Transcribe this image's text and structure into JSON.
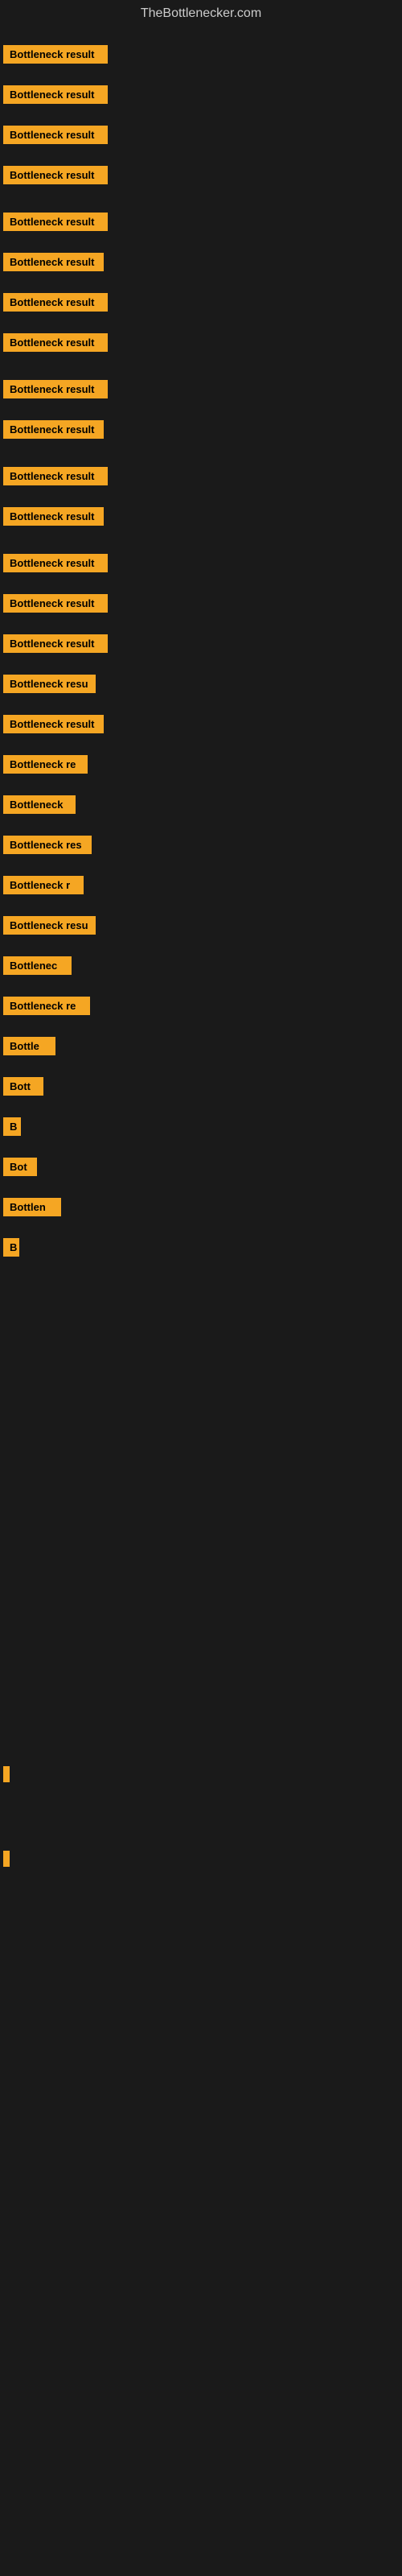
{
  "site": {
    "title": "TheBottlenecker.com"
  },
  "bars": [
    {
      "id": 1,
      "label": "Bottleneck result",
      "width": 130
    },
    {
      "id": 2,
      "label": "Bottleneck result",
      "width": 130
    },
    {
      "id": 3,
      "label": "Bottleneck result",
      "width": 130
    },
    {
      "id": 4,
      "label": "Bottleneck result",
      "width": 130
    },
    {
      "id": 5,
      "label": "Bottleneck result",
      "width": 130
    },
    {
      "id": 6,
      "label": "Bottleneck result",
      "width": 125
    },
    {
      "id": 7,
      "label": "Bottleneck result",
      "width": 130
    },
    {
      "id": 8,
      "label": "Bottleneck result",
      "width": 130
    },
    {
      "id": 9,
      "label": "Bottleneck result",
      "width": 130
    },
    {
      "id": 10,
      "label": "Bottleneck result",
      "width": 125
    },
    {
      "id": 11,
      "label": "Bottleneck result",
      "width": 130
    },
    {
      "id": 12,
      "label": "Bottleneck result",
      "width": 125
    },
    {
      "id": 13,
      "label": "Bottleneck result",
      "width": 130
    },
    {
      "id": 14,
      "label": "Bottleneck result",
      "width": 130
    },
    {
      "id": 15,
      "label": "Bottleneck result",
      "width": 130
    },
    {
      "id": 16,
      "label": "Bottleneck resu",
      "width": 115
    },
    {
      "id": 17,
      "label": "Bottleneck result",
      "width": 125
    },
    {
      "id": 18,
      "label": "Bottleneck re",
      "width": 105
    },
    {
      "id": 19,
      "label": "Bottleneck",
      "width": 90
    },
    {
      "id": 20,
      "label": "Bottleneck res",
      "width": 110
    },
    {
      "id": 21,
      "label": "Bottleneck r",
      "width": 100
    },
    {
      "id": 22,
      "label": "Bottleneck resu",
      "width": 115
    },
    {
      "id": 23,
      "label": "Bottlenec",
      "width": 85
    },
    {
      "id": 24,
      "label": "Bottleneck re",
      "width": 108
    },
    {
      "id": 25,
      "label": "Bottle",
      "width": 65
    },
    {
      "id": 26,
      "label": "Bott",
      "width": 50
    },
    {
      "id": 27,
      "label": "B",
      "width": 22
    },
    {
      "id": 28,
      "label": "Bot",
      "width": 42
    },
    {
      "id": 29,
      "label": "Bottlen",
      "width": 72
    },
    {
      "id": 30,
      "label": "B",
      "width": 20
    }
  ],
  "bottom_bars": [
    {
      "id": 31,
      "width": 8
    },
    {
      "id": 32,
      "width": 8
    }
  ],
  "accent_color": "#f5a623"
}
